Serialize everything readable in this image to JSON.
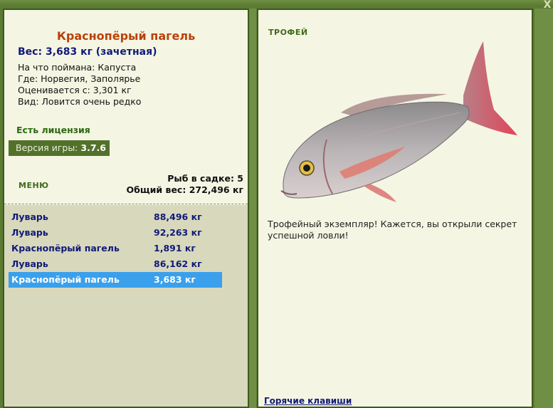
{
  "window": {
    "close_label": "X"
  },
  "fish": {
    "title": "Краснопёрый пагель",
    "weight_line": "Вес: 3,683 кг (зачетная)",
    "bait_line": "На что поймана: Капуста",
    "place_line": "Где: Норвегия, Заполярье",
    "value_line": "Оценивается с: 3,301 кг",
    "rarity_line": "Вид: Ловится очень редко"
  },
  "license": "Есть лицензия",
  "version": {
    "label": "Версия игры:",
    "number": "3.7.6"
  },
  "menu_label": "МЕНЮ",
  "keepnet": {
    "count_line": "Рыб в садке: 5",
    "total_line": "Общий вес: 272,496 кг"
  },
  "catch_list": [
    {
      "name": "Луварь",
      "weight": "88,496 кг"
    },
    {
      "name": "Луварь",
      "weight": "92,263 кг"
    },
    {
      "name": "Краснопёрый пагель",
      "weight": "1,891 кг"
    },
    {
      "name": "Луварь",
      "weight": "86,162 кг"
    },
    {
      "name": "Краснопёрый пагель",
      "weight": "3,683 кг"
    }
  ],
  "selected_index": 4,
  "trophy": {
    "label": "ТРОФЕЙ",
    "text": "Трофейный экземпляр! Кажется, вы открыли секрет успешной ловли!"
  },
  "hotkeys_label": "Горячие клавиши",
  "colors": {
    "frame": "#5b7a32",
    "panel": "#f5f5e3",
    "title": "#b8420b",
    "link_blue": "#101a78",
    "selected": "#3aa0ec"
  }
}
